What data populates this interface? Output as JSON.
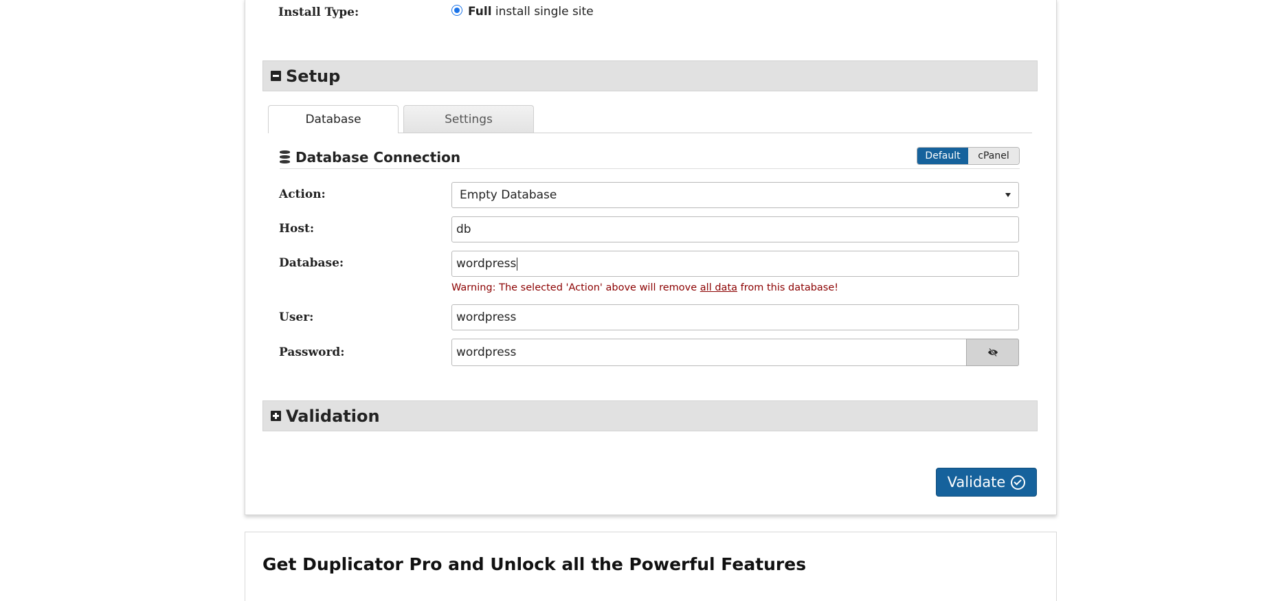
{
  "install": {
    "label": "Install Type:",
    "option_bold": "Full",
    "option_rest": " install single site"
  },
  "setup": {
    "title": "Setup",
    "tabs": [
      {
        "label": "Database",
        "active": true
      },
      {
        "label": "Settings",
        "active": false
      }
    ],
    "db_connection": {
      "title": "Database Connection",
      "modes": [
        {
          "label": "Default",
          "active": true
        },
        {
          "label": "cPanel",
          "active": false
        }
      ]
    },
    "fields": {
      "action": {
        "label": "Action:",
        "value": "Empty Database"
      },
      "host": {
        "label": "Host:",
        "value": "db"
      },
      "database": {
        "label": "Database:",
        "value": "wordpress"
      },
      "user": {
        "label": "User:",
        "value": "wordpress"
      },
      "password": {
        "label": "Password:",
        "value": "wordpress"
      }
    },
    "warning": {
      "before": "Warning: The selected 'Action' above will remove ",
      "link": "all data",
      "after": " from this database!"
    }
  },
  "validation": {
    "title": "Validation"
  },
  "validate_button": {
    "label": "Validate"
  },
  "promo": {
    "title": "Get Duplicator Pro and Unlock all the Powerful Features"
  },
  "colors": {
    "primary": "#16629c",
    "warning": "#8b0000",
    "section_bg": "#e1e1e1"
  }
}
